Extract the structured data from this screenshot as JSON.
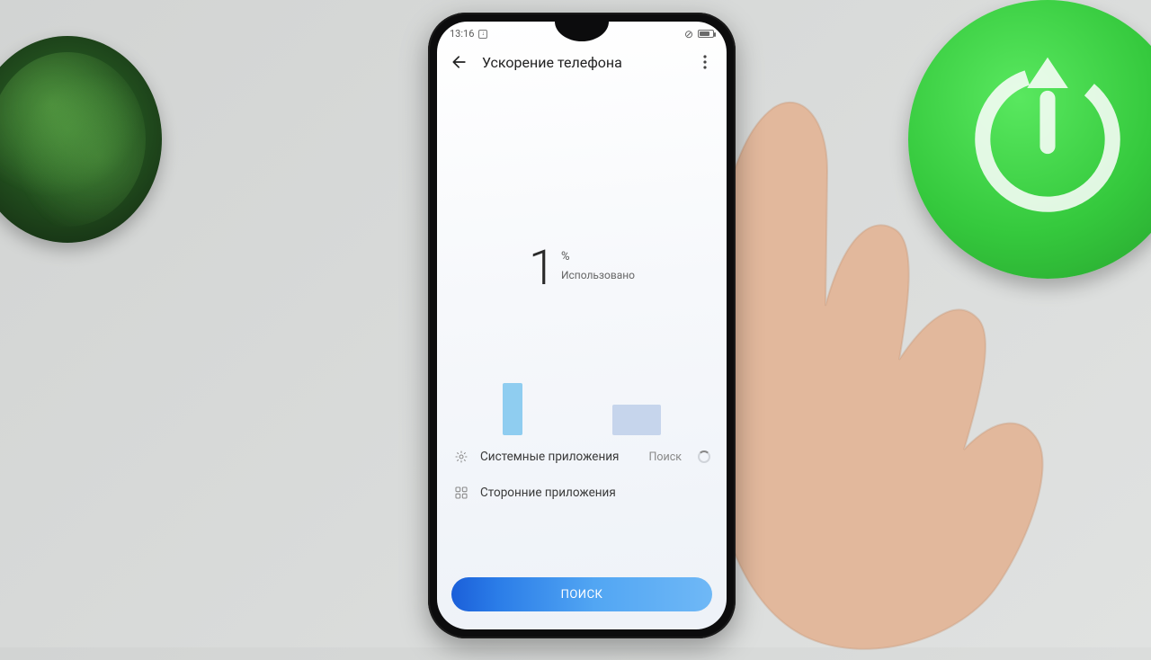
{
  "status_bar": {
    "time": "13:16"
  },
  "header": {
    "title": "Ускорение телефона"
  },
  "usage": {
    "value": "1",
    "unit": "%",
    "label": "Использовано"
  },
  "rows": {
    "system": {
      "label": "Системные приложения",
      "meta": "Поиск"
    },
    "third_party": {
      "label": "Сторонние приложения"
    }
  },
  "cta": {
    "label": "ПОИСК"
  }
}
